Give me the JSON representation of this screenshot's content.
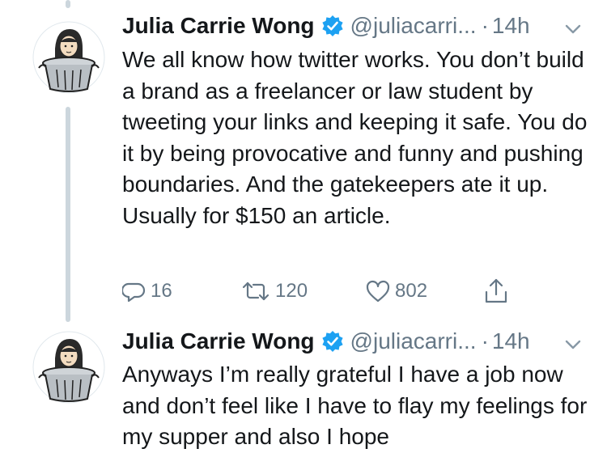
{
  "tweets": [
    {
      "name": "Julia Carrie Wong",
      "handle": "@juliacarri...",
      "separator": "·",
      "time": "14h",
      "text": "We all know how twitter works. You don’t build a brand as a freelancer or law student by tweeting your links and keeping it safe. You do it by being provocative and funny and pushing boundaries. And the gatekeepers ate it up. Usually for $150 an article.",
      "replies": "16",
      "retweets": "120",
      "likes": "802"
    },
    {
      "name": "Julia Carrie Wong",
      "handle": "@juliacarri...",
      "separator": "·",
      "time": "14h",
      "text": "Anyways I’m really grateful I have a job now and don’t feel like I have to flay my feelings for my supper and also I hope"
    }
  ],
  "colors": {
    "text": "#14171a",
    "secondary": "#657786",
    "verified": "#1da1f2",
    "thread_line": "#ccd6dd"
  },
  "icons": [
    "verified-badge-icon",
    "chevron-down-icon",
    "reply-icon",
    "retweet-icon",
    "like-icon",
    "share-icon"
  ]
}
